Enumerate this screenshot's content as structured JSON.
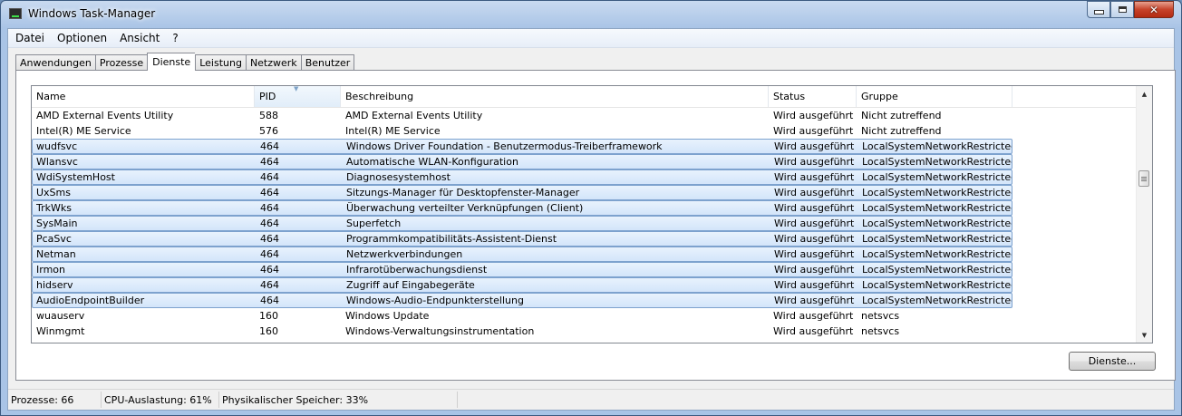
{
  "window": {
    "title": "Windows Task-Manager"
  },
  "menu": [
    "Datei",
    "Optionen",
    "Ansicht",
    "?"
  ],
  "tabs": [
    "Anwendungen",
    "Prozesse",
    "Dienste",
    "Leistung",
    "Netzwerk",
    "Benutzer"
  ],
  "active_tab": "Dienste",
  "columns": [
    "Name",
    "PID",
    "Beschreibung",
    "Status",
    "Gruppe"
  ],
  "sorted_column": "PID",
  "rows": [
    {
      "name": "AMD External Events Utility",
      "pid": "588",
      "desc": "AMD External Events Utility",
      "status": "Wird ausgeführt",
      "group": "Nicht zutreffend",
      "selected": false
    },
    {
      "name": "Intel(R) ME Service",
      "pid": "576",
      "desc": "Intel(R) ME Service",
      "status": "Wird ausgeführt",
      "group": "Nicht zutreffend",
      "selected": false
    },
    {
      "name": "wudfsvc",
      "pid": "464",
      "desc": "Windows Driver Foundation - Benutzermodus-Treiberframework",
      "status": "Wird ausgeführt",
      "group": "LocalSystemNetworkRestricted",
      "selected": true
    },
    {
      "name": "Wlansvc",
      "pid": "464",
      "desc": "Automatische WLAN-Konfiguration",
      "status": "Wird ausgeführt",
      "group": "LocalSystemNetworkRestricted",
      "selected": true
    },
    {
      "name": "WdiSystemHost",
      "pid": "464",
      "desc": "Diagnosesystemhost",
      "status": "Wird ausgeführt",
      "group": "LocalSystemNetworkRestricted",
      "selected": true
    },
    {
      "name": "UxSms",
      "pid": "464",
      "desc": "Sitzungs-Manager für Desktopfenster-Manager",
      "status": "Wird ausgeführt",
      "group": "LocalSystemNetworkRestricted",
      "selected": true
    },
    {
      "name": "TrkWks",
      "pid": "464",
      "desc": "Überwachung verteilter Verknüpfungen (Client)",
      "status": "Wird ausgeführt",
      "group": "LocalSystemNetworkRestricted",
      "selected": true
    },
    {
      "name": "SysMain",
      "pid": "464",
      "desc": "Superfetch",
      "status": "Wird ausgeführt",
      "group": "LocalSystemNetworkRestricted",
      "selected": true
    },
    {
      "name": "PcaSvc",
      "pid": "464",
      "desc": "Programmkompatibilitäts-Assistent-Dienst",
      "status": "Wird ausgeführt",
      "group": "LocalSystemNetworkRestricted",
      "selected": true
    },
    {
      "name": "Netman",
      "pid": "464",
      "desc": "Netzwerkverbindungen",
      "status": "Wird ausgeführt",
      "group": "LocalSystemNetworkRestricted",
      "selected": true
    },
    {
      "name": "Irmon",
      "pid": "464",
      "desc": "Infrarotüberwachungsdienst",
      "status": "Wird ausgeführt",
      "group": "LocalSystemNetworkRestricted",
      "selected": true
    },
    {
      "name": "hidserv",
      "pid": "464",
      "desc": "Zugriff auf Eingabegeräte",
      "status": "Wird ausgeführt",
      "group": "LocalSystemNetworkRestricted",
      "selected": true
    },
    {
      "name": "AudioEndpointBuilder",
      "pid": "464",
      "desc": "Windows-Audio-Endpunkterstellung",
      "status": "Wird ausgeführt",
      "group": "LocalSystemNetworkRestricted",
      "selected": true
    },
    {
      "name": "wuauserv",
      "pid": "160",
      "desc": "Windows Update",
      "status": "Wird ausgeführt",
      "group": "netsvcs",
      "selected": false
    },
    {
      "name": "Winmgmt",
      "pid": "160",
      "desc": "Windows-Verwaltungsinstrumentation",
      "status": "Wird ausgeführt",
      "group": "netsvcs",
      "selected": false
    }
  ],
  "button": {
    "services_label": "Dienste..."
  },
  "statusbar": {
    "processes": "Prozesse: 66",
    "cpu": "CPU-Auslastung: 61%",
    "memory": "Physikalischer Speicher: 33%"
  },
  "scroll": {
    "position": 0.33
  },
  "colors": {
    "selection_fill": "#dbe9fa",
    "selection_border": "#7da2ce",
    "close_button": "#c7432a"
  }
}
